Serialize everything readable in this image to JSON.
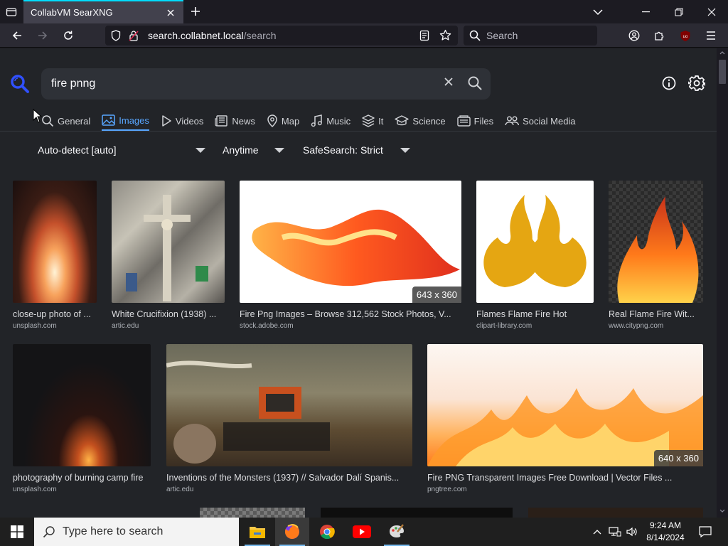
{
  "browser": {
    "tab_title": "CollabVM SearXNG",
    "url_host": "search.collabnet.local",
    "url_path": "/search",
    "search_placeholder": "Search"
  },
  "search": {
    "query": "fire pnng"
  },
  "categories": [
    {
      "label": "General",
      "icon": "search-icon"
    },
    {
      "label": "Images",
      "icon": "image-icon",
      "active": true
    },
    {
      "label": "Videos",
      "icon": "play-icon"
    },
    {
      "label": "News",
      "icon": "newspaper-icon"
    },
    {
      "label": "Map",
      "icon": "map-pin-icon"
    },
    {
      "label": "Music",
      "icon": "music-icon"
    },
    {
      "label": "It",
      "icon": "layers-icon"
    },
    {
      "label": "Science",
      "icon": "science-icon"
    },
    {
      "label": "Files",
      "icon": "files-icon"
    },
    {
      "label": "Social Media",
      "icon": "people-icon"
    }
  ],
  "filters": {
    "language": "Auto-detect [auto]",
    "time": "Anytime",
    "safesearch": "SafeSearch: Strict"
  },
  "results": [
    {
      "title": "close-up photo of ...",
      "source": "unsplash.com"
    },
    {
      "title": "White Crucifixion (1938) ...",
      "source": "artic.edu"
    },
    {
      "title": "Fire Png Images – Browse 312,562 Stock Photos, V...",
      "source": "stock.adobe.com",
      "dims": "643 x 360"
    },
    {
      "title": "Flames Flame Fire Hot",
      "source": "clipart-library.com"
    },
    {
      "title": "Real Flame Fire Wit...",
      "source": "www.citypng.com"
    },
    {
      "title": "photography of burning camp fire",
      "source": "unsplash.com"
    },
    {
      "title": "Inventions of the Monsters (1937) // Salvador Dalí Spanis...",
      "source": "artic.edu"
    },
    {
      "title": "Fire PNG Transparent Images Free Download | Vector Files ...",
      "source": "pngtree.com",
      "dims": "640 x 360"
    }
  ],
  "taskbar": {
    "search_placeholder": "Type here to search",
    "time": "9:24 AM",
    "date": "8/14/2024"
  },
  "colors": {
    "accent": "#58a6ff",
    "tab_highlight": "#00ddff"
  }
}
